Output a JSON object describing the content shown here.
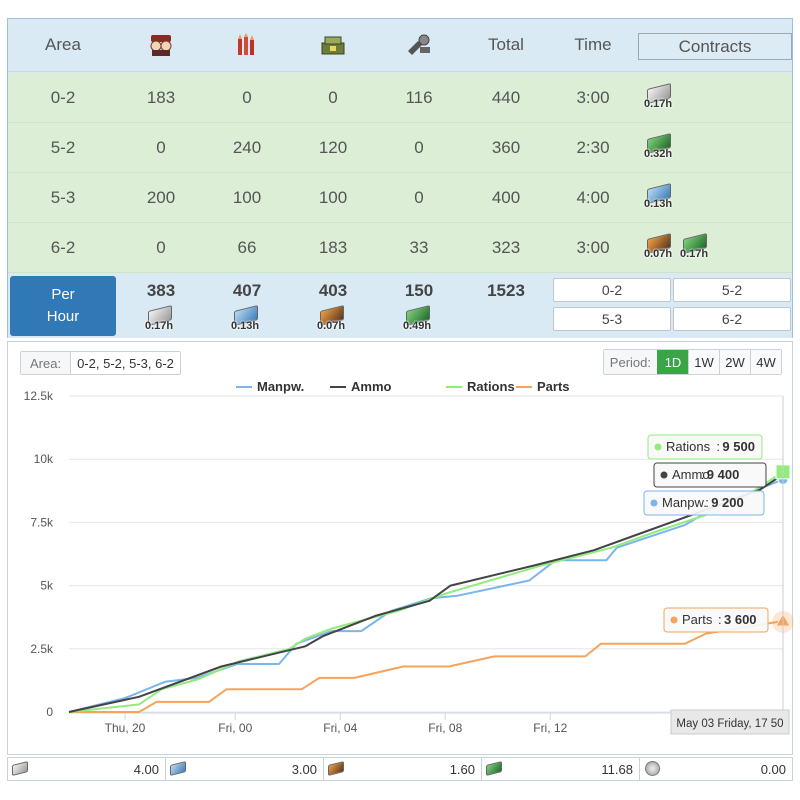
{
  "table": {
    "headers": {
      "area": "Area",
      "manpower_icon": "manpower-icon",
      "ammo_icon": "ammo-icon",
      "rations_icon": "rations-icon",
      "parts_icon": "parts-icon",
      "total": "Total",
      "time": "Time",
      "contracts": "Contracts"
    },
    "rows": [
      {
        "area": "0-2",
        "manpower": "183",
        "ammo": "0",
        "rations": "0",
        "parts": "116",
        "total": "440",
        "time": "3:00",
        "contracts": [
          {
            "icon": "t-doll-contract-icon",
            "label": "0.17h",
            "style": "gen"
          }
        ]
      },
      {
        "area": "5-2",
        "manpower": "0",
        "ammo": "240",
        "rations": "120",
        "parts": "0",
        "total": "360",
        "time": "2:30",
        "contracts": [
          {
            "icon": "quick-repair-icon",
            "label": "0.32h",
            "style": "amm"
          }
        ]
      },
      {
        "area": "5-3",
        "manpower": "200",
        "ammo": "100",
        "rations": "100",
        "parts": "0",
        "total": "400",
        "time": "4:00",
        "contracts": [
          {
            "icon": "quick-production-icon",
            "label": "0.13h",
            "style": "eq"
          }
        ]
      },
      {
        "area": "6-2",
        "manpower": "0",
        "ammo": "66",
        "rations": "183",
        "parts": "33",
        "total": "323",
        "time": "3:00",
        "contracts": [
          {
            "icon": "equipment-contract-icon",
            "label": "0.07h",
            "style": "prod"
          },
          {
            "icon": "quick-repair-icon",
            "label": "0.17h",
            "style": "amm"
          }
        ]
      }
    ],
    "per_hour": {
      "label_line1": "Per",
      "label_line2": "Hour",
      "manpower": "383",
      "ammo": "407",
      "rations": "403",
      "parts": "150",
      "total": "1523",
      "contracts": [
        {
          "icon": "t-doll-contract-icon",
          "label": "0.17h",
          "style": "gen"
        },
        {
          "icon": "quick-production-icon",
          "label": "0.13h",
          "style": "eq"
        },
        {
          "icon": "equipment-contract-icon",
          "label": "0.07h",
          "style": "prod"
        },
        {
          "icon": "quick-repair-icon",
          "label": "0.49h",
          "style": "amm"
        }
      ],
      "areas": [
        "0-2",
        "5-2",
        "5-3",
        "6-2"
      ]
    }
  },
  "chart_controls": {
    "area_label": "Area:",
    "area_value": "0-2, 5-2, 5-3, 6-2",
    "period_label": "Period:",
    "periods": [
      "1D",
      "1W",
      "2W",
      "4W"
    ],
    "active_period": "1D"
  },
  "chart_data": {
    "type": "line",
    "legend_position": "top",
    "series": [
      {
        "name": "Manpw.",
        "color": "#7cb5ec",
        "points": [
          [
            0,
            0
          ],
          [
            3.2,
            550
          ],
          [
            5.5,
            1200
          ],
          [
            7.3,
            1350
          ],
          [
            9.6,
            1900
          ],
          [
            12,
            1900
          ],
          [
            13,
            2700
          ],
          [
            15,
            3200
          ],
          [
            16.7,
            3200
          ],
          [
            18.4,
            4000
          ],
          [
            20.7,
            4500
          ],
          [
            22.2,
            4600
          ],
          [
            26.3,
            5200
          ],
          [
            27.8,
            6000
          ],
          [
            30.7,
            6000
          ],
          [
            31.3,
            6500
          ],
          [
            35.2,
            7400
          ],
          [
            37.2,
            8200
          ],
          [
            40.8,
            9200
          ]
        ],
        "end_value": "9 200"
      },
      {
        "name": "Ammo",
        "color": "#434348",
        "points": [
          [
            0,
            0
          ],
          [
            4,
            600
          ],
          [
            8.7,
            1800
          ],
          [
            10.5,
            2100
          ],
          [
            13.5,
            2600
          ],
          [
            14.5,
            3000
          ],
          [
            17.5,
            3800
          ],
          [
            20.6,
            4400
          ],
          [
            21.8,
            5000
          ],
          [
            26.6,
            5800
          ],
          [
            30,
            6400
          ],
          [
            32.4,
            7000
          ],
          [
            36,
            7900
          ],
          [
            39.5,
            8800
          ],
          [
            40.8,
            9400
          ]
        ],
        "end_value": "9 400"
      },
      {
        "name": "Rations",
        "color": "#90ed7d",
        "points": [
          [
            0,
            0
          ],
          [
            4,
            300
          ],
          [
            5.3,
            900
          ],
          [
            7.4,
            1300
          ],
          [
            9.7,
            2000
          ],
          [
            12.6,
            2500
          ],
          [
            13.5,
            2900
          ],
          [
            15,
            3300
          ],
          [
            18.8,
            4000
          ],
          [
            21.6,
            4700
          ],
          [
            27,
            5800
          ],
          [
            31,
            6500
          ],
          [
            33.4,
            7100
          ],
          [
            37.7,
            8100
          ],
          [
            40.8,
            9500
          ]
        ],
        "end_value": "9 500"
      },
      {
        "name": "Parts",
        "color": "#f7a35c",
        "points": [
          [
            0,
            0
          ],
          [
            4,
            0
          ],
          [
            5,
            400
          ],
          [
            8,
            400
          ],
          [
            9,
            900
          ],
          [
            13.3,
            900
          ],
          [
            14.3,
            1350
          ],
          [
            16.3,
            1350
          ],
          [
            19.1,
            1800
          ],
          [
            21.7,
            1800
          ],
          [
            24.3,
            2200
          ],
          [
            29.5,
            2200
          ],
          [
            30.4,
            2700
          ],
          [
            35.2,
            2700
          ],
          [
            36.4,
            3100
          ],
          [
            40.8,
            3600
          ]
        ],
        "end_value": "3 600"
      }
    ],
    "x_ticks": [
      {
        "v": 3.2,
        "label": "Thu, 20"
      },
      {
        "v": 9.5,
        "label": "Fri, 00"
      },
      {
        "v": 15.5,
        "label": "Fri, 04"
      },
      {
        "v": 21.5,
        "label": "Fri, 08"
      },
      {
        "v": 27.5,
        "label": "Fri, 12"
      }
    ],
    "xlim": [
      0,
      40.8
    ],
    "y_ticks": [
      0,
      2500,
      5000,
      7500,
      10000,
      12500
    ],
    "y_tick_labels": [
      "0",
      "2.5k",
      "5k",
      "7.5k",
      "10k",
      "12.5k"
    ],
    "ylim": [
      0,
      12500
    ],
    "grid": true,
    "tooltip_date": "May 03 Friday, 17 50"
  },
  "footer": [
    {
      "icon": "t-doll-contract-icon",
      "style": "gen",
      "value": "4.00"
    },
    {
      "icon": "quick-production-icon",
      "style": "eq",
      "value": "3.00"
    },
    {
      "icon": "equipment-contract-icon",
      "style": "prod",
      "value": "1.60"
    },
    {
      "icon": "quick-repair-icon",
      "style": "amm",
      "value": "11.68"
    },
    {
      "icon": "token-icon",
      "style": "round",
      "value": "0.00"
    }
  ]
}
